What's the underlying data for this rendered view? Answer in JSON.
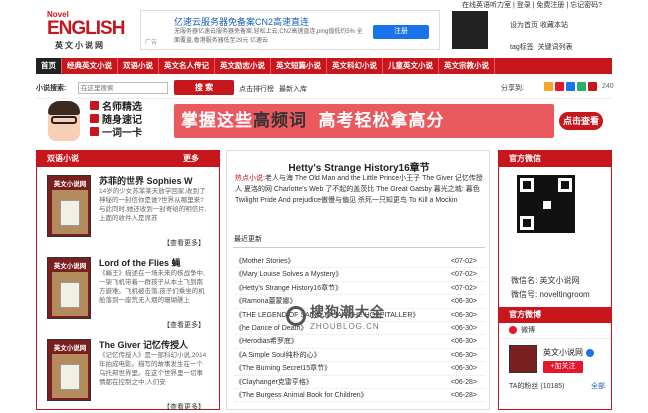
{
  "header": {
    "logo": {
      "novel": "Novel",
      "english": "ENGLISH",
      "cn": "英文小说网"
    },
    "ad": {
      "line1": "亿速云服务器免备案CN2高速直连",
      "line2": "无服务器亿速云服务器免备案,轻松上云,CN2高速直连,ping值低约5% 全面覆盖,香港服务器低至29元 亿速云",
      "button": "注册",
      "tag": "广告"
    },
    "toplinks": "在线英语听力室 | 登录 | 免费注册 | 忘记密码?",
    "links": [
      "设为首页",
      "收藏本站",
      "tag标签",
      "关键词列表"
    ]
  },
  "nav": {
    "items": [
      "首页",
      "经典英文小说",
      "双语小说",
      "英文名人传记",
      "英文励志小说",
      "英文短篇小说",
      "英文科幻小说",
      "儿童英文小说",
      "英文宗教小说"
    ]
  },
  "search": {
    "label": "小说搜索:",
    "placeholder": "在这里搜索",
    "button": "搜 索",
    "hot1": "点击排行榜",
    "hot2": "最新入库",
    "share": "分享到:",
    "count": "240"
  },
  "banner": {
    "badge1": "名师精选",
    "badge2": "随身速记",
    "badge3": "一词一卡",
    "slogan_a": "掌握这些",
    "slogan_b": "高频词",
    "slogan_c": "高考轻松拿高分",
    "button": "点击查看"
  },
  "left": {
    "title": "双语小说",
    "more": "更多",
    "cover_label": "英文小说网",
    "books": [
      {
        "title": "苏菲的世界 Sophies W",
        "desc": "14岁的少女苏菲某天放学回家,收到了神秘的一封信你是谁?世界从哪里来?与此同时,她还收到一封寄给的明信片,上面的收件人是席苏",
        "more": "【查看更多】"
      },
      {
        "title": "Lord of the Flies 蝇",
        "desc": "《蝇王》描述在一场未来的核战争中,一架飞机带着一群孩子从本土飞到南方避难。飞机被击落,孩子们乘坐的机舱落到一座荒无人烟的珊瑚礁上",
        "more": "【查看更多】"
      },
      {
        "title": "The Giver 记忆传授人",
        "desc": "《记忆传授人》是一部科幻小说,2014年拍成电影。描写的故事发生在一个乌托邦世界里。在这个世界里一切事情都在控制之中,人们安",
        "more": "【查看更多】"
      }
    ]
  },
  "center": {
    "title": "Hetty's Strange History16章节",
    "hot_label": "热点小说:",
    "hot_text": "老人与海 The Old Man and the Little Prince小王子 The Giver 记忆传授人 夏洛的网 Charlotte's Web 了不起的盖茨比 The Great Gatsby 暮光之城: 暮色 Twilight Pride And prejudice傲慢与偏见 杀死一只知更鸟 To Kill a Mockin",
    "recent": "最近更新",
    "list": [
      {
        "t": "《Mother Stories》",
        "d": "<07-02>"
      },
      {
        "t": "《Mary Louise Solves a Mystery》",
        "d": "<07-02>"
      },
      {
        "t": "《Hetty's Strange History16章节》",
        "d": "<07-02>"
      },
      {
        "t": "《Ramona蕾蒙娜》",
        "d": "<06-30>"
      },
      {
        "t": "《THE LEGEND OF SAINT JULIAN THE HOSPITALLER》",
        "d": "<06-30>"
      },
      {
        "t": "《he Dance of Death》",
        "d": "<06-30>"
      },
      {
        "t": "《Herodias希罗底》",
        "d": "<06-30>"
      },
      {
        "t": "《A Simple Soul纯朴的心》",
        "d": "<06-30>"
      },
      {
        "t": "《The Burning Secret15章节》",
        "d": "<06-30>"
      },
      {
        "t": "《Clayhanger克雷亨格》",
        "d": "<06-28>"
      },
      {
        "t": "《The Burgess Animal Book for Children》",
        "d": "<06-28>"
      }
    ]
  },
  "right": {
    "title1": "官方微信",
    "wx_name": "微信名: 英文小说网",
    "wx_id": "微信号: noveltingroom",
    "title2": "官方微博",
    "weibo_tab": "微博",
    "account": "英文小说网",
    "follow": "+加关注",
    "fans": "TA的粉丝 (10185)",
    "all": "全部"
  },
  "watermark": {
    "cn": "搜狗潮大全",
    "en": "ZHOUBLOG.CN"
  },
  "colors": {
    "brand": "#c8161d",
    "banner": "#e9595e",
    "link": "#1a5fb4"
  }
}
